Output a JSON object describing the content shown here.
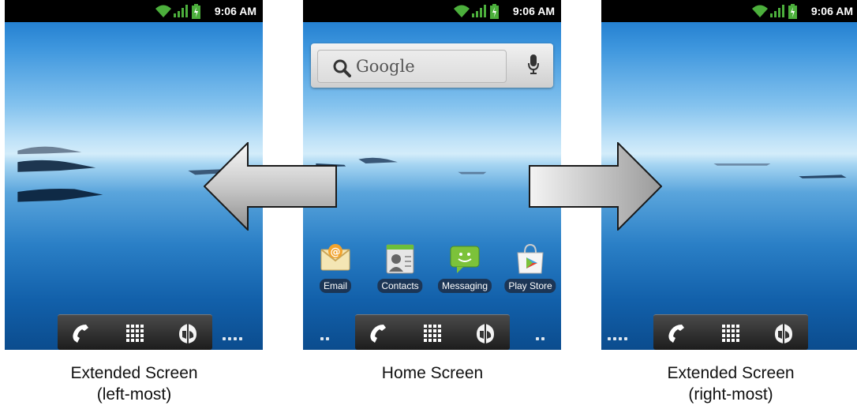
{
  "status_time": "9:06 AM",
  "search": {
    "placeholder": "Google"
  },
  "apps": [
    {
      "label": "Email",
      "icon": "email-icon"
    },
    {
      "label": "Contacts",
      "icon": "contacts-icon"
    },
    {
      "label": "Messaging",
      "icon": "messaging-icon"
    },
    {
      "label": "Play Store",
      "icon": "play-store-icon"
    }
  ],
  "dock_icons": [
    "phone-icon",
    "app-grid-icon",
    "browser-icon"
  ],
  "captions": {
    "left": {
      "line1": "Extended Screen",
      "line2": "(left-most)"
    },
    "home": {
      "line1": "Home Screen"
    },
    "right": {
      "line1": "Extended Screen",
      "line2": "(right-most)"
    }
  },
  "arrows": [
    "left-arrow",
    "right-arrow"
  ]
}
